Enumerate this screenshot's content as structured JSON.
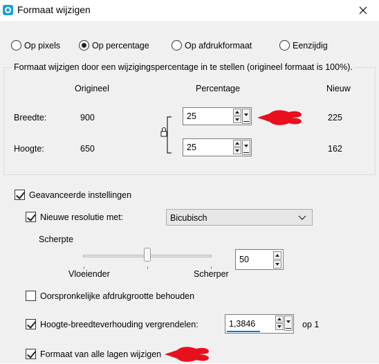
{
  "window": {
    "title": "Formaat wijzigen"
  },
  "mode_options": [
    {
      "label": "Op pixels",
      "selected": false
    },
    {
      "label": "Op percentage",
      "selected": true
    },
    {
      "label": "Op afdrukformaat",
      "selected": false
    },
    {
      "label": "Eenzijdig",
      "selected": false
    }
  ],
  "resize_group": {
    "legend": "Formaat wijzigen door een wijzigingspercentage in te stellen (origineel formaat  is 100%).",
    "col_original": "Origineel",
    "col_percentage": "Percentage",
    "col_new": "Nieuw",
    "width": {
      "label": "Breedte:",
      "original": "900",
      "percentage": "25",
      "new": "225"
    },
    "height": {
      "label": "Hoogte:",
      "original": "650",
      "percentage": "25",
      "new": "162"
    }
  },
  "advanced": {
    "label": "Geavanceerde instellingen",
    "checked": true,
    "resample": {
      "label": "Nieuwe resolutie met:",
      "checked": true,
      "method": "Bicubisch"
    },
    "sharpness": {
      "label": "Scherpte",
      "min_label": "Vloeiender",
      "max_label": "Scherper",
      "value": "50"
    },
    "keep_print_size": {
      "label": "Oorspronkelijke afdrukgrootte behouden",
      "checked": false
    },
    "lock_aspect": {
      "label": "Hoogte-breedteverhouding vergrendelen:",
      "checked": true,
      "value": "1,3846",
      "suffix": "op 1"
    },
    "resize_all_layers": {
      "label": "Formaat van alle lagen wijzigen",
      "checked": true
    }
  },
  "colors": {
    "annotation_red": "#e8101c",
    "accent_blue": "#0078d7"
  }
}
